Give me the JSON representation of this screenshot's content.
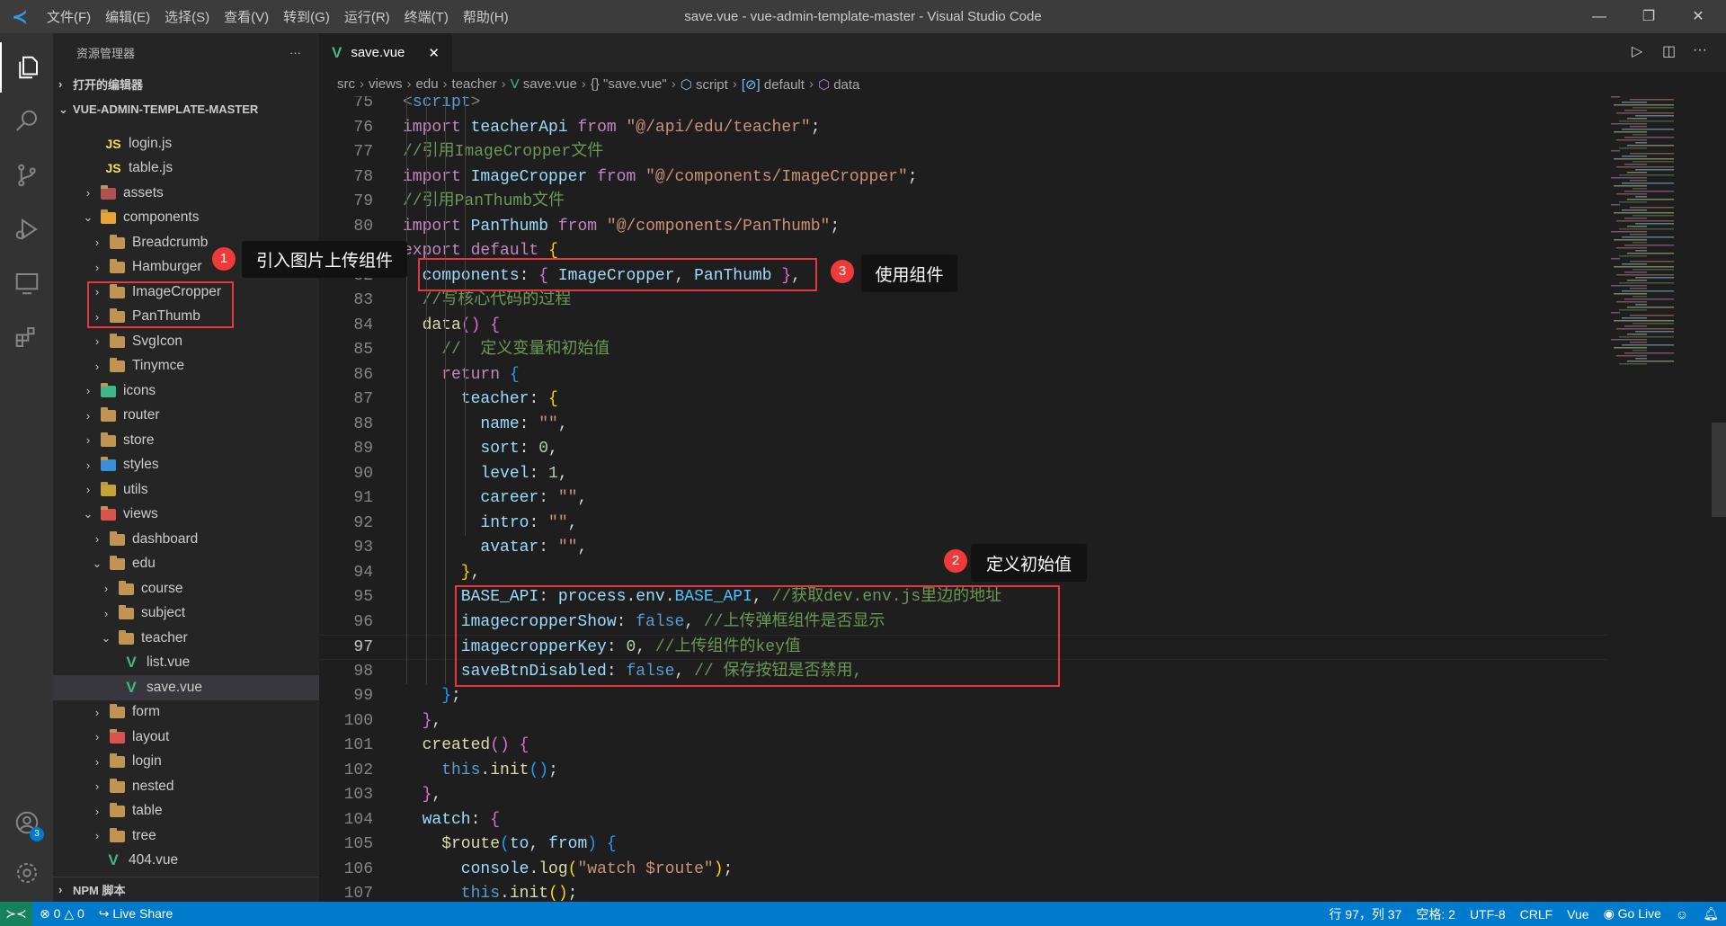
{
  "titlebar": {
    "menus": [
      "文件(F)",
      "编辑(E)",
      "选择(S)",
      "查看(V)",
      "转到(G)",
      "运行(R)",
      "终端(T)",
      "帮助(H)"
    ],
    "title": "save.vue - vue-admin-template-master - Visual Studio Code"
  },
  "sidebar": {
    "title": "资源管理器",
    "more": "···",
    "open_editors": "打开的编辑器",
    "project": "VUE-ADMIN-TEMPLATE-MASTER",
    "npm": "NPM 脚本",
    "items": [
      {
        "label": "login.js",
        "level": 3,
        "icon": "js",
        "state": "file"
      },
      {
        "label": "table.js",
        "level": 3,
        "icon": "js",
        "state": "file"
      },
      {
        "label": "assets",
        "level": 1,
        "icon": "folder-assets",
        "state": "closed"
      },
      {
        "label": "components",
        "level": 1,
        "icon": "folder-components",
        "state": "open"
      },
      {
        "label": "Breadcrumb",
        "level": 2,
        "icon": "folder",
        "state": "closed"
      },
      {
        "label": "Hamburger",
        "level": 2,
        "icon": "folder",
        "state": "closed"
      },
      {
        "label": "ImageCropper",
        "level": 2,
        "icon": "folder",
        "state": "closed"
      },
      {
        "label": "PanThumb",
        "level": 2,
        "icon": "folder",
        "state": "closed"
      },
      {
        "label": "SvgIcon",
        "level": 2,
        "icon": "folder",
        "state": "closed"
      },
      {
        "label": "Tinymce",
        "level": 2,
        "icon": "folder",
        "state": "closed"
      },
      {
        "label": "icons",
        "level": 1,
        "icon": "folder-images",
        "state": "closed"
      },
      {
        "label": "router",
        "level": 1,
        "icon": "folder",
        "state": "closed"
      },
      {
        "label": "store",
        "level": 1,
        "icon": "folder",
        "state": "closed"
      },
      {
        "label": "styles",
        "level": 1,
        "icon": "folder-styles",
        "state": "closed"
      },
      {
        "label": "utils",
        "level": 1,
        "icon": "folder-utils",
        "state": "closed"
      },
      {
        "label": "views",
        "level": 1,
        "icon": "folder-views",
        "state": "open"
      },
      {
        "label": "dashboard",
        "level": 2,
        "icon": "folder",
        "state": "closed"
      },
      {
        "label": "edu",
        "level": 2,
        "icon": "folder",
        "state": "open"
      },
      {
        "label": "course",
        "level": 3,
        "icon": "folder",
        "state": "closed"
      },
      {
        "label": "subject",
        "level": 3,
        "icon": "folder",
        "state": "closed"
      },
      {
        "label": "teacher",
        "level": 3,
        "icon": "folder",
        "state": "open"
      },
      {
        "label": "list.vue",
        "level": 5,
        "icon": "vue",
        "state": "file"
      },
      {
        "label": "save.vue",
        "level": 5,
        "icon": "vue",
        "state": "file",
        "selected": true
      },
      {
        "label": "form",
        "level": 2,
        "icon": "folder",
        "state": "closed"
      },
      {
        "label": "layout",
        "level": 2,
        "icon": "folder-layout",
        "state": "closed"
      },
      {
        "label": "login",
        "level": 2,
        "icon": "folder",
        "state": "closed"
      },
      {
        "label": "nested",
        "level": 2,
        "icon": "folder",
        "state": "closed"
      },
      {
        "label": "table",
        "level": 2,
        "icon": "folder",
        "state": "closed"
      },
      {
        "label": "tree",
        "level": 2,
        "icon": "folder",
        "state": "closed"
      },
      {
        "label": "404.vue",
        "level": 3,
        "icon": "vue",
        "state": "file"
      }
    ]
  },
  "tab": {
    "label": "save.vue",
    "close": "✕"
  },
  "breadcrumb": [
    "src",
    "views",
    "edu",
    "teacher",
    "save.vue",
    "{} \"save.vue\"",
    "script",
    "default",
    "data"
  ],
  "editor": {
    "current_line": 97,
    "lines": [
      {
        "n": "75",
        "t": [
          [
            "<",
            "t"
          ],
          [
            "script",
            "bl"
          ],
          [
            ">",
            "t"
          ]
        ]
      },
      {
        "n": "76",
        "t": [
          [
            "import",
            "k"
          ],
          [
            " ",
            "w"
          ],
          [
            "teacherApi",
            "v"
          ],
          [
            " ",
            "w"
          ],
          [
            "from",
            "k"
          ],
          [
            " ",
            "w"
          ],
          [
            "\"@/api/edu/teacher\"",
            "s"
          ],
          [
            ";",
            "w"
          ]
        ]
      },
      {
        "n": "77",
        "t": [
          [
            "//引用ImageCropper文件",
            "c"
          ]
        ]
      },
      {
        "n": "78",
        "t": [
          [
            "import",
            "k"
          ],
          [
            " ",
            "w"
          ],
          [
            "ImageCropper",
            "v"
          ],
          [
            " ",
            "w"
          ],
          [
            "from",
            "k"
          ],
          [
            " ",
            "w"
          ],
          [
            "\"@/components/ImageCropper\"",
            "s"
          ],
          [
            ";",
            "w"
          ]
        ]
      },
      {
        "n": "79",
        "t": [
          [
            "//引用PanThumb文件",
            "c"
          ]
        ]
      },
      {
        "n": "80",
        "t": [
          [
            "import",
            "k"
          ],
          [
            " ",
            "w"
          ],
          [
            "PanThumb",
            "v"
          ],
          [
            " ",
            "w"
          ],
          [
            "from",
            "k"
          ],
          [
            " ",
            "w"
          ],
          [
            "\"@/components/PanThumb\"",
            "s"
          ],
          [
            ";",
            "w"
          ]
        ]
      },
      {
        "n": "81",
        "t": [
          [
            "export",
            "k"
          ],
          [
            " ",
            "w"
          ],
          [
            "default",
            "k"
          ],
          [
            " ",
            "w"
          ],
          [
            "{",
            "y"
          ]
        ]
      },
      {
        "n": "82",
        "t": [
          [
            "  components",
            "v"
          ],
          [
            ": ",
            "w"
          ],
          [
            "{",
            "p"
          ],
          [
            " ",
            "w"
          ],
          [
            "ImageCropper",
            "v"
          ],
          [
            ", ",
            "w"
          ],
          [
            "PanThumb",
            "v"
          ],
          [
            " ",
            "w"
          ],
          [
            "}",
            "p"
          ],
          [
            ",",
            "w"
          ]
        ]
      },
      {
        "n": "83",
        "t": [
          [
            "  //写核心代码的过程",
            "c"
          ]
        ]
      },
      {
        "n": "84",
        "t": [
          [
            "  data",
            "f"
          ],
          [
            "()",
            "p"
          ],
          [
            " ",
            "w"
          ],
          [
            "{",
            "p"
          ]
        ]
      },
      {
        "n": "85",
        "t": [
          [
            "    //  定义变量和初始值",
            "c"
          ]
        ]
      },
      {
        "n": "86",
        "t": [
          [
            "    return",
            "k"
          ],
          [
            " ",
            "w"
          ],
          [
            "{",
            "b"
          ]
        ]
      },
      {
        "n": "87",
        "t": [
          [
            "      teacher",
            "v"
          ],
          [
            ": ",
            "w"
          ],
          [
            "{",
            "y"
          ]
        ]
      },
      {
        "n": "88",
        "t": [
          [
            "        name",
            "v"
          ],
          [
            ": ",
            "w"
          ],
          [
            "\"\"",
            "s"
          ],
          [
            ",",
            "w"
          ]
        ]
      },
      {
        "n": "89",
        "t": [
          [
            "        sort",
            "v"
          ],
          [
            ": ",
            "w"
          ],
          [
            "0",
            "n"
          ],
          [
            ",",
            "w"
          ]
        ]
      },
      {
        "n": "90",
        "t": [
          [
            "        level",
            "v"
          ],
          [
            ": ",
            "w"
          ],
          [
            "1",
            "n"
          ],
          [
            ",",
            "w"
          ]
        ]
      },
      {
        "n": "91",
        "t": [
          [
            "        career",
            "v"
          ],
          [
            ": ",
            "w"
          ],
          [
            "\"\"",
            "s"
          ],
          [
            ",",
            "w"
          ]
        ]
      },
      {
        "n": "92",
        "t": [
          [
            "        intro",
            "v"
          ],
          [
            ": ",
            "w"
          ],
          [
            "\"\"",
            "s"
          ],
          [
            ",",
            "w"
          ]
        ]
      },
      {
        "n": "93",
        "t": [
          [
            "        avatar",
            "v"
          ],
          [
            ": ",
            "w"
          ],
          [
            "\"\"",
            "s"
          ],
          [
            ",",
            "w"
          ]
        ]
      },
      {
        "n": "94",
        "t": [
          [
            "      }",
            "y"
          ],
          [
            ",",
            "w"
          ]
        ]
      },
      {
        "n": "95",
        "t": [
          [
            "      BASE_API",
            "v"
          ],
          [
            ": ",
            "w"
          ],
          [
            "process",
            "v"
          ],
          [
            ".",
            "w"
          ],
          [
            "env",
            "v"
          ],
          [
            ".",
            "w"
          ],
          [
            "BASE_API",
            "cn"
          ],
          [
            ", ",
            "w"
          ],
          [
            "//获取dev.env.js里边的地址",
            "c"
          ]
        ]
      },
      {
        "n": "96",
        "t": [
          [
            "      imagecropperShow",
            "v"
          ],
          [
            ": ",
            "w"
          ],
          [
            "false",
            "bl"
          ],
          [
            ", ",
            "w"
          ],
          [
            "//上传弹框组件是否显示",
            "c"
          ]
        ]
      },
      {
        "n": "97",
        "t": [
          [
            "      imagecropperKey",
            "v"
          ],
          [
            ": ",
            "w"
          ],
          [
            "0",
            "n"
          ],
          [
            ", ",
            "w"
          ],
          [
            "//上传组件的key值",
            "c"
          ]
        ]
      },
      {
        "n": "98",
        "t": [
          [
            "      saveBtnDisabled",
            "v"
          ],
          [
            ": ",
            "w"
          ],
          [
            "false",
            "bl"
          ],
          [
            ", ",
            "w"
          ],
          [
            "// 保存按钮是否禁用,",
            "c"
          ]
        ]
      },
      {
        "n": "99",
        "t": [
          [
            "    }",
            "b"
          ],
          [
            ";",
            "w"
          ]
        ]
      },
      {
        "n": "100",
        "t": [
          [
            "  }",
            "p"
          ],
          [
            ",",
            "w"
          ]
        ]
      },
      {
        "n": "101",
        "t": [
          [
            "  created",
            "f"
          ],
          [
            "()",
            "p"
          ],
          [
            " ",
            "w"
          ],
          [
            "{",
            "p"
          ]
        ]
      },
      {
        "n": "102",
        "t": [
          [
            "    this",
            "bl"
          ],
          [
            ".",
            "w"
          ],
          [
            "init",
            "f"
          ],
          [
            "()",
            "b"
          ],
          [
            ";",
            "w"
          ]
        ]
      },
      {
        "n": "103",
        "t": [
          [
            "  }",
            "p"
          ],
          [
            ",",
            "w"
          ]
        ]
      },
      {
        "n": "104",
        "t": [
          [
            "  watch",
            "v"
          ],
          [
            ": ",
            "w"
          ],
          [
            "{",
            "p"
          ]
        ]
      },
      {
        "n": "105",
        "t": [
          [
            "    $route",
            "f"
          ],
          [
            "(",
            "b"
          ],
          [
            "to",
            "v"
          ],
          [
            ", ",
            "w"
          ],
          [
            "from",
            "v"
          ],
          [
            ")",
            "b"
          ],
          [
            " ",
            "w"
          ],
          [
            "{",
            "b"
          ]
        ]
      },
      {
        "n": "106",
        "t": [
          [
            "      console",
            "v"
          ],
          [
            ".",
            "w"
          ],
          [
            "log",
            "f"
          ],
          [
            "(",
            "y"
          ],
          [
            "\"watch $route\"",
            "s"
          ],
          [
            ")",
            "y"
          ],
          [
            ";",
            "w"
          ]
        ]
      },
      {
        "n": "107",
        "t": [
          [
            "      this",
            "bl"
          ],
          [
            ".",
            "w"
          ],
          [
            "init",
            "f"
          ],
          [
            "()",
            "y"
          ],
          [
            ";",
            "w"
          ]
        ]
      }
    ]
  },
  "annotations": [
    {
      "badge": "1",
      "label": "引入图片上传组件"
    },
    {
      "badge": "2",
      "label": "定义初始值"
    },
    {
      "badge": "3",
      "label": "使用组件"
    }
  ],
  "statusbar": {
    "errors": "0",
    "warnings": "0",
    "live_share": "Live Share",
    "position": "行 97，列 37",
    "spaces": "空格: 2",
    "encoding": "UTF-8",
    "eol": "CRLF",
    "language": "Vue",
    "go_live": "Go Live"
  },
  "activity": {
    "accounts_badge": "3"
  },
  "colors": {
    "accent": "#007acc",
    "annotation_red": "#e8373a",
    "remote": "#16825d"
  }
}
